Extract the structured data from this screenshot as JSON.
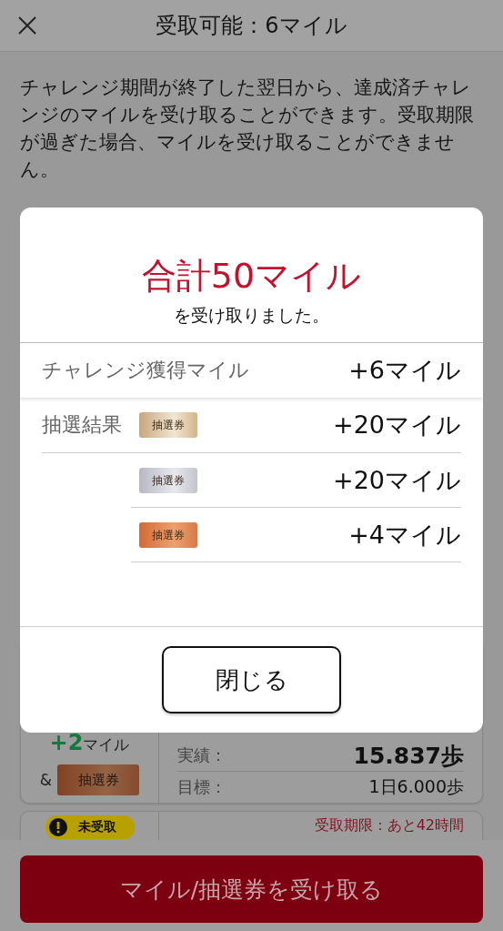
{
  "header": {
    "title": "受取可能：6マイル"
  },
  "notice": "チャレンジ期間が終了した翌日から、達成済チャレンジのマイルを受け取ることができます。受取期限が過ぎた場合、マイルを受け取ることができません。",
  "challenge_card": {
    "miles_amount": "+2",
    "miles_unit": "マイル",
    "and": "&",
    "ticket": {
      "label": "抽選券",
      "kind": "bronze"
    },
    "actual_label": "実績：",
    "actual_value": "15.837歩",
    "goal_label": "目標：",
    "goal_value": "1日6.000歩"
  },
  "pending_card": {
    "badge": "未受取",
    "deadline": "受取期限：あと42時間"
  },
  "receive_button": "マイル/抽選券を受け取る",
  "modal": {
    "total": "合計50マイル",
    "subtitle": "を受け取りました。",
    "challenge_row": {
      "label": "チャレンジ獲得マイル",
      "value": "+6マイル"
    },
    "lottery": {
      "label": "抽選結果",
      "rows": [
        {
          "ticket": "抽選券",
          "kind": "gold",
          "value": "+20マイル"
        },
        {
          "ticket": "抽選券",
          "kind": "silver",
          "value": "+20マイル"
        },
        {
          "ticket": "抽選券",
          "kind": "bronze",
          "value": "+4マイル"
        }
      ]
    },
    "close_button": "閉じる"
  }
}
